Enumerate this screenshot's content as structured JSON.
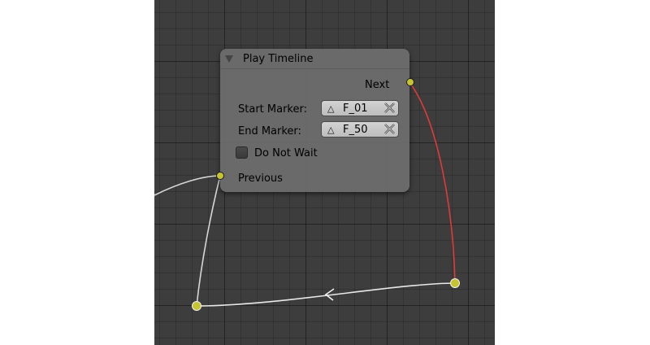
{
  "node": {
    "title": "Play Timeline",
    "next_label": "Next",
    "start_marker_label": "Start Marker:",
    "start_marker_value": "F_01",
    "end_marker_label": "End Marker:",
    "end_marker_value": "F_50",
    "do_not_wait_label": "Do Not Wait",
    "do_not_wait_checked": false,
    "previous_label": "Previous",
    "marker_icon": "triangle-icon",
    "clear_icon": "x-icon"
  },
  "colors": {
    "editor_background": "#3d3d3d",
    "node_body": "#6e6e6e",
    "socket": "#c6c432",
    "active_link": "#e03a3a",
    "link": "#dcdcdc"
  }
}
